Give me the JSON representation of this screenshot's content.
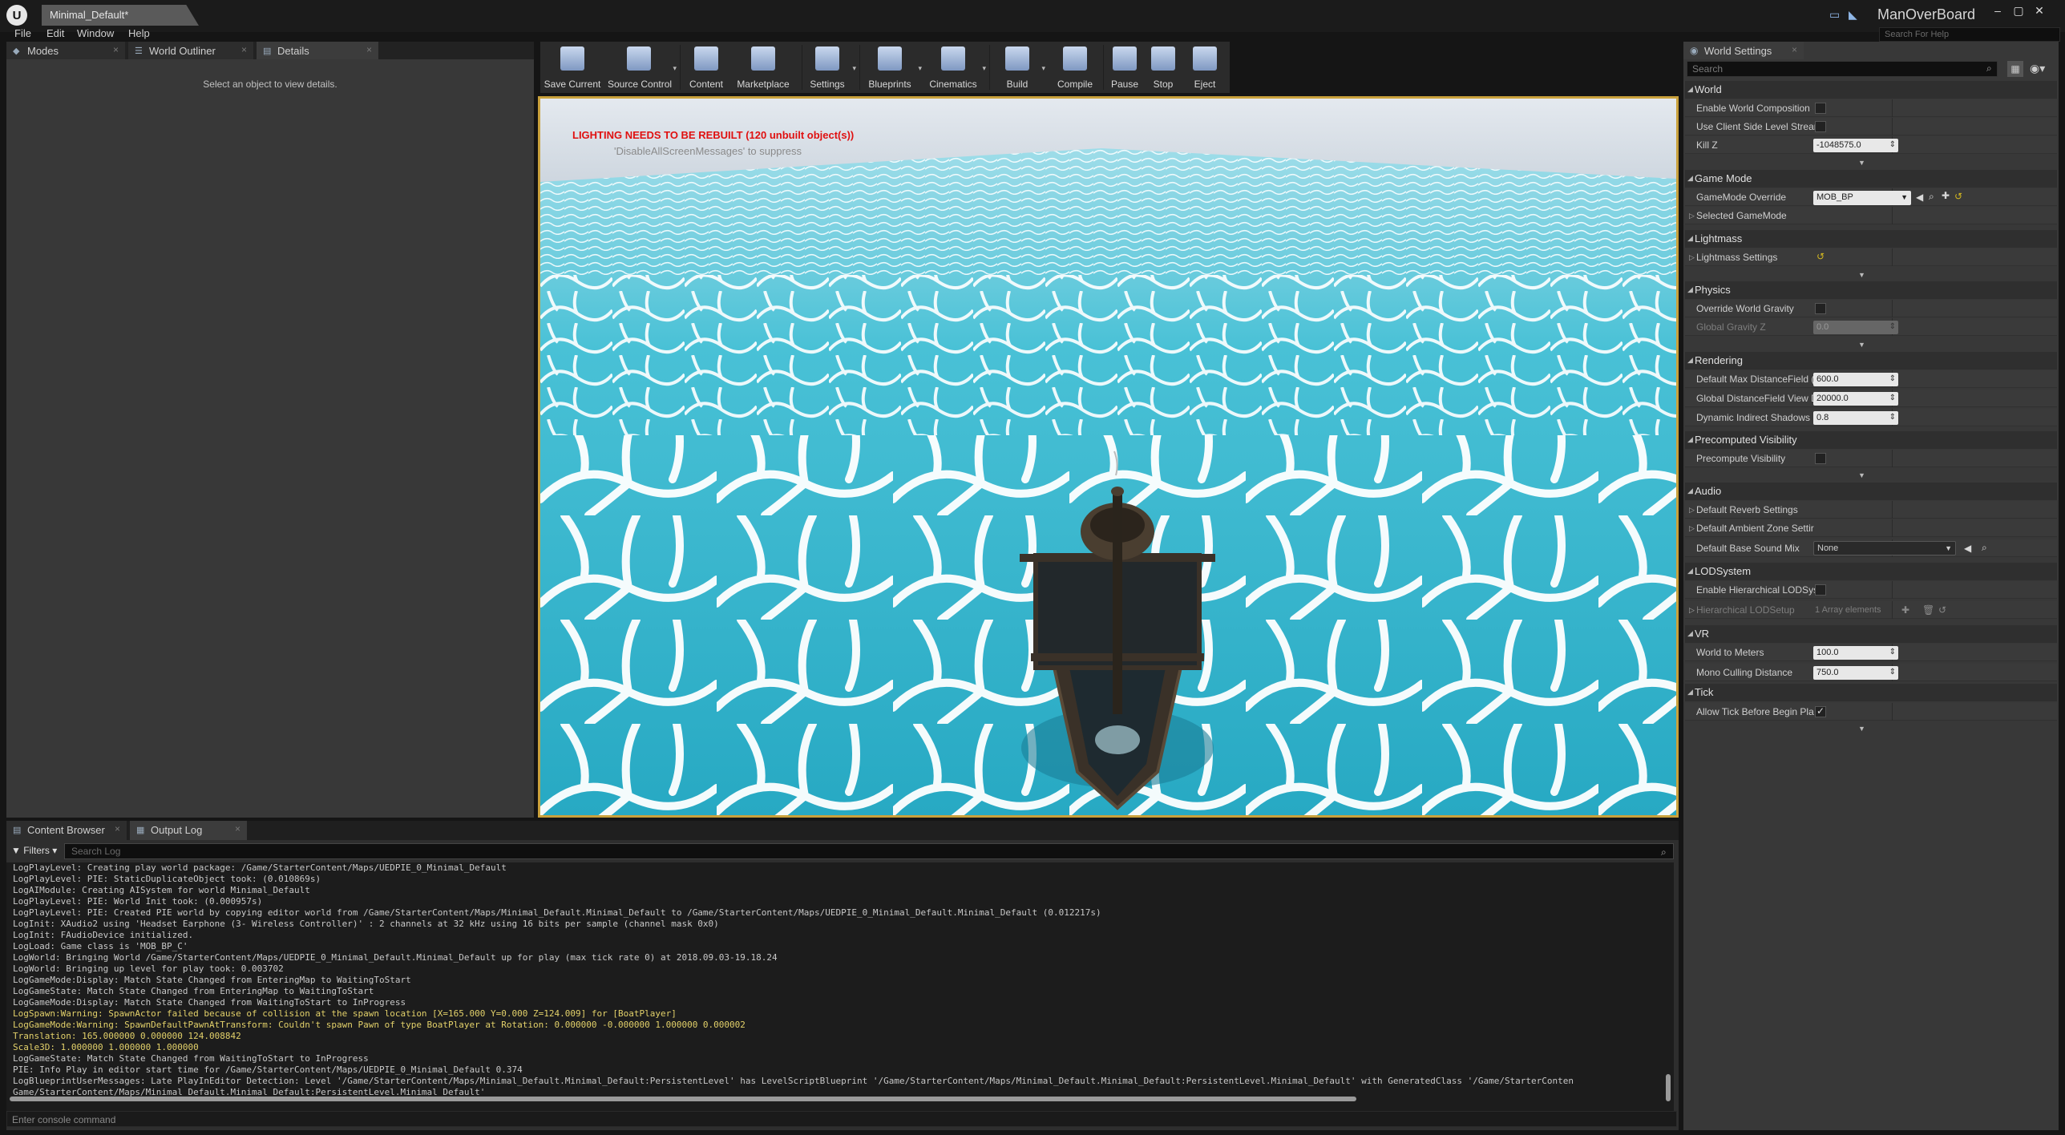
{
  "window": {
    "doc_tab": "Minimal_Default*",
    "project_name": "ManOverBoard",
    "help_search_placeholder": "Search For Help"
  },
  "menu": [
    "File",
    "Edit",
    "Window",
    "Help"
  ],
  "left_tabs": [
    {
      "label": "Modes",
      "icon": "modes-icon"
    },
    {
      "label": "World Outliner",
      "icon": "outliner-icon"
    },
    {
      "label": "Details",
      "icon": "details-icon"
    }
  ],
  "details_hint": "Select an object to view details.",
  "toolbar": [
    {
      "label": "Save Current",
      "icon": "save-icon"
    },
    {
      "label": "Source Control",
      "icon": "source-control-icon"
    },
    {
      "label": "Content",
      "icon": "content-icon"
    },
    {
      "label": "Marketplace",
      "icon": "marketplace-icon"
    },
    {
      "label": "Settings",
      "icon": "settings-icon"
    },
    {
      "label": "Blueprints",
      "icon": "blueprints-icon"
    },
    {
      "label": "Cinematics",
      "icon": "cinematics-icon"
    },
    {
      "label": "Build",
      "icon": "build-icon"
    },
    {
      "label": "Compile",
      "icon": "compile-icon"
    },
    {
      "label": "Pause",
      "icon": "pause-icon"
    },
    {
      "label": "Stop",
      "icon": "stop-icon"
    },
    {
      "label": "Eject",
      "icon": "eject-icon"
    }
  ],
  "viewport": {
    "warning": "LIGHTING NEEDS TO BE REBUILT (120 unbuilt object(s))",
    "suppress": "'DisableAllScreenMessages' to suppress",
    "sky_color": "#dfe6ee",
    "water_color": "#2fb6cf",
    "foam_color": "#ffffff",
    "highlight_color": "#c9a13c"
  },
  "bottom_tabs": [
    {
      "label": "Content Browser",
      "icon": "content-browser-icon"
    },
    {
      "label": "Output Log",
      "icon": "output-log-icon"
    }
  ],
  "log": {
    "filters_label": "Filters",
    "search_placeholder": "Search Log",
    "console_placeholder": "Enter console command",
    "lines": [
      {
        "text": "LogPlayLevel: Creating play world package: /Game/StarterContent/Maps/UEDPIE_0_Minimal_Default",
        "level": "normal"
      },
      {
        "text": "LogPlayLevel: PIE: StaticDuplicateObject took: (0.010869s)",
        "level": "normal"
      },
      {
        "text": "LogAIModule: Creating AISystem for world Minimal_Default",
        "level": "normal"
      },
      {
        "text": "LogPlayLevel: PIE: World Init took: (0.000957s)",
        "level": "normal"
      },
      {
        "text": "LogPlayLevel: PIE: Created PIE world by copying editor world from /Game/StarterContent/Maps/Minimal_Default.Minimal_Default to /Game/StarterContent/Maps/UEDPIE_0_Minimal_Default.Minimal_Default (0.012217s)",
        "level": "normal"
      },
      {
        "text": "LogInit: XAudio2 using 'Headset Earphone (3- Wireless Controller)' : 2 channels at 32 kHz using 16 bits per sample (channel mask 0x0)",
        "level": "normal"
      },
      {
        "text": "LogInit: FAudioDevice initialized.",
        "level": "normal"
      },
      {
        "text": "LogLoad: Game class is 'MOB_BP_C'",
        "level": "normal"
      },
      {
        "text": "LogWorld: Bringing World /Game/StarterContent/Maps/UEDPIE_0_Minimal_Default.Minimal_Default up for play (max tick rate 0) at 2018.09.03-19.18.24",
        "level": "normal"
      },
      {
        "text": "LogWorld: Bringing up level for play took: 0.003702",
        "level": "normal"
      },
      {
        "text": "LogGameMode:Display: Match State Changed from EnteringMap to WaitingToStart",
        "level": "normal"
      },
      {
        "text": "LogGameState: Match State Changed from EnteringMap to WaitingToStart",
        "level": "normal"
      },
      {
        "text": "LogGameMode:Display: Match State Changed from WaitingToStart to InProgress",
        "level": "normal"
      },
      {
        "text": "LogSpawn:Warning: SpawnActor failed because of collision at the spawn location [X=165.000 Y=0.000 Z=124.009] for [BoatPlayer]",
        "level": "warn"
      },
      {
        "text": "LogGameMode:Warning: SpawnDefaultPawnAtTransform: Couldn't spawn Pawn of type BoatPlayer at Rotation: 0.000000 -0.000000 1.000000 0.000002",
        "level": "warn"
      },
      {
        "text": "Translation: 165.000000 0.000000 124.008842",
        "level": "warn"
      },
      {
        "text": "Scale3D: 1.000000 1.000000 1.000000",
        "level": "warn"
      },
      {
        "text": "LogGameState: Match State Changed from WaitingToStart to InProgress",
        "level": "normal"
      },
      {
        "text": "PIE: Info Play in editor start time for /Game/StarterContent/Maps/UEDPIE_0_Minimal_Default 0.374",
        "level": "normal"
      },
      {
        "text": "LogBlueprintUserMessages: Late PlayInEditor Detection: Level '/Game/StarterContent/Maps/Minimal_Default.Minimal_Default:PersistentLevel' has LevelScriptBlueprint '/Game/StarterContent/Maps/Minimal_Default.Minimal_Default:PersistentLevel.Minimal_Default' with GeneratedClass '/Game/StarterConten",
        "level": "normal"
      },
      {
        "text": "Game/StarterContent/Maps/Minimal_Default.Minimal_Default:PersistentLevel.Minimal_Default'",
        "level": "normal"
      }
    ]
  },
  "world_settings": {
    "tab_label": "World Settings",
    "search_placeholder": "Search",
    "world": {
      "title": "World",
      "enable_world_composition": "Enable World Composition",
      "use_client_side": "Use Client Side Level Strear",
      "kill_z": "Kill Z",
      "kill_z_value": "-1048575.0"
    },
    "game_mode": {
      "title": "Game Mode",
      "override": "GameMode Override",
      "override_value": "MOB_BP",
      "selected": "Selected GameMode"
    },
    "lightmass": {
      "title": "Lightmass",
      "settings": "Lightmass Settings"
    },
    "physics": {
      "title": "Physics",
      "override_gravity": "Override World Gravity",
      "global_gravity": "Global Gravity Z",
      "global_gravity_value": "0.0"
    },
    "rendering": {
      "title": "Rendering",
      "max_df": "Default Max DistanceField (",
      "max_df_value": "600.0",
      "global_df": "Global DistanceField View D",
      "global_df_value": "20000.0",
      "dyn_indirect": "Dynamic Indirect Shadows (",
      "dyn_indirect_value": "0.8"
    },
    "precomputed": {
      "title": "Precomputed Visibility",
      "precompute": "Precompute Visibility"
    },
    "audio": {
      "title": "Audio",
      "reverb": "Default Reverb Settings",
      "ambient": "Default Ambient Zone Settir",
      "sound_mix": "Default Base Sound Mix",
      "sound_mix_value": "None"
    },
    "lod": {
      "title": "LODSystem",
      "enable": "Enable Hierarchical LODSys",
      "setup": "Hierarchical LODSetup",
      "setup_value": "1 Array elements"
    },
    "vr": {
      "title": "VR",
      "world_to_meters": "World to Meters",
      "world_to_meters_value": "100.0",
      "mono_culling": "Mono Culling Distance",
      "mono_culling_value": "750.0"
    },
    "tick": {
      "title": "Tick",
      "allow_tick": "Allow Tick Before Begin Pla"
    }
  }
}
